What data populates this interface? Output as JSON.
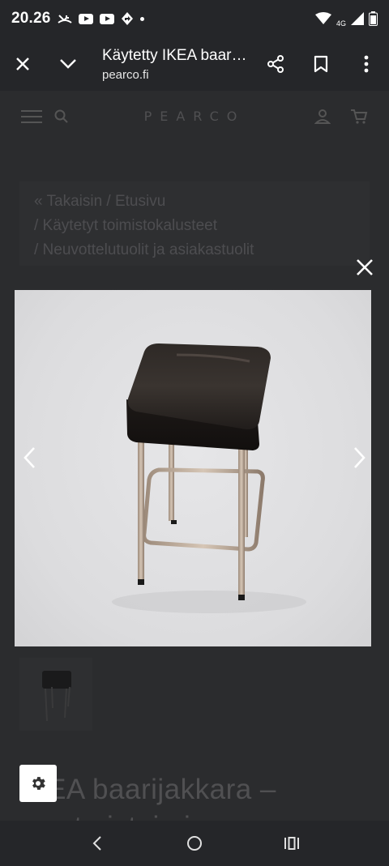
{
  "status_bar": {
    "time": "20.26",
    "network": "4G"
  },
  "tab_bar": {
    "title": "Käytetty IKEA baarijakkara",
    "url": "pearco.fi"
  },
  "site": {
    "logo": "PEARCO"
  },
  "breadcrumb": {
    "line1": "« Takaisin  /  Etusivu",
    "line2": "/  Käytetyt toimistokalusteet",
    "line3": "/  Neuvottelutuolit ja asiakastuolit"
  },
  "product": {
    "title_line1": "IKEA baarijakkara –",
    "title_line2": "musta istuin ja"
  },
  "icons": {
    "close_tab": "close-icon",
    "collapse": "chevron-down-icon",
    "share": "share-icon",
    "bookmark": "bookmark-icon",
    "more": "more-vertical-icon",
    "menu": "hamburger-icon",
    "search": "search-icon",
    "account": "account-icon",
    "cart": "cart-icon",
    "lightbox_close": "close-icon",
    "prev": "chevron-left-icon",
    "next": "chevron-right-icon",
    "settings": "gear-icon"
  },
  "colors": {
    "system_bar": "#252629",
    "overlay_page": "#2b2c2e",
    "image_bg": "#dcdcde"
  }
}
